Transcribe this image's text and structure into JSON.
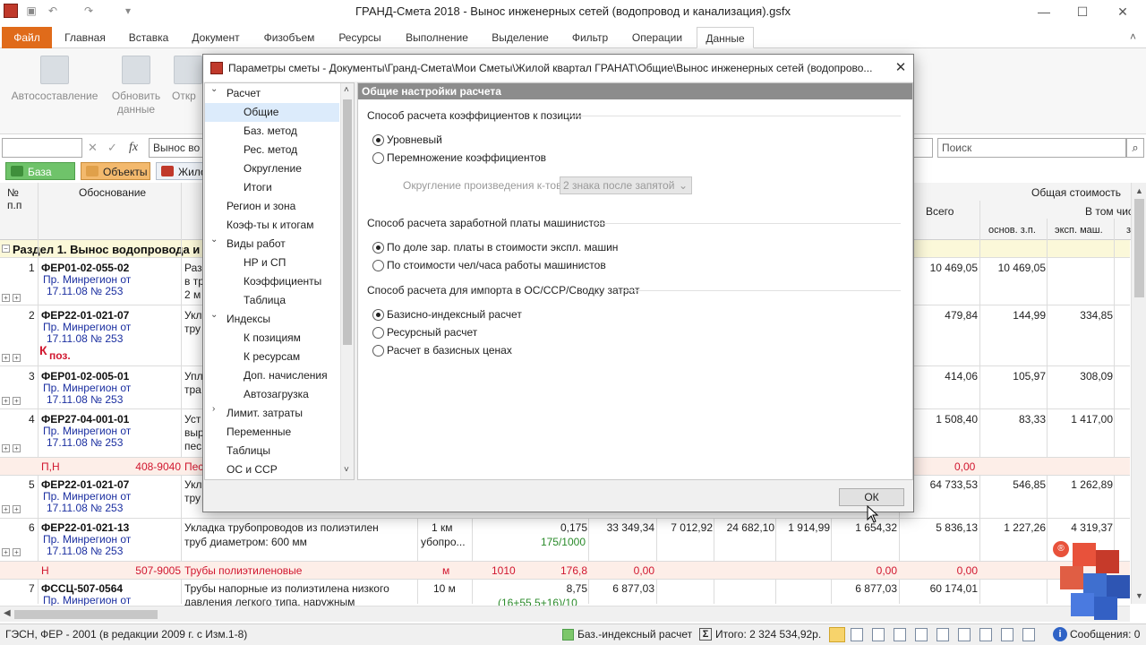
{
  "app": {
    "title": "ГРАНД-Смета 2018 - Вынос инженерных сетей (водопровод и канализация).gsfx"
  },
  "window_controls": {
    "minimize": "—",
    "maximize": "☐",
    "close": "✕"
  },
  "ribbon": {
    "tabs": [
      "Файл",
      "Главная",
      "Вставка",
      "Документ",
      "Физобъем",
      "Ресурсы",
      "Выполнение",
      "Выделение",
      "Фильтр",
      "Операции",
      "Данные"
    ],
    "active_tab": "Данные",
    "buttons": {
      "auto_compose": "Автосоставление",
      "update_data_1": "Обновить",
      "update_data_2": "данные",
      "open_partial": "Откр"
    }
  },
  "formula_bar": {
    "cell_value": "Вынос во",
    "search_placeholder": "Поиск",
    "fx": "fx"
  },
  "source_tabs": {
    "base": "База",
    "objects": "Объекты",
    "residential": "Жило"
  },
  "grid": {
    "headers": {
      "num": "№ п.п",
      "basis": "Обоснование",
      "total_cost": "Общая стоимость",
      "total": "Всего",
      "incl": "В том чис",
      "base_salary": "основ. з.п.",
      "machine_exp": "эксп. маш."
    },
    "section_title": "Раздел 1. Вынос водопровода и",
    "rows": [
      {
        "n": "1",
        "code": "ФЕР01-02-055-02",
        "src1": "Пр. Минрегион от",
        "src2": "17.11.08 № 253",
        "desc": "Раз",
        "desc2": "в тр",
        "desc3": "2 м",
        "total": "10 469,05",
        "base": "10 469,05",
        "mach": ""
      },
      {
        "n": "2",
        "code": "ФЕР22-01-021-07",
        "src1": "Пр. Минрегион от",
        "src2": "17.11.08 № 253",
        "desc": "Укл",
        "desc2": "тру",
        "kpos_k": "К",
        "kpos": "поз.",
        "total": "479,84",
        "base": "144,99",
        "mach": "334,85"
      },
      {
        "n": "3",
        "code": "ФЕР01-02-005-01",
        "src1": "Пр. Минрегион от",
        "src2": "17.11.08 № 253",
        "desc": "Упл",
        "desc2": "тра",
        "total": "414,06",
        "base": "105,97",
        "mach": "308,09"
      },
      {
        "n": "4",
        "code": "ФЕР27-04-001-01",
        "src1": "Пр. Минрегион от",
        "src2": "17.11.08 № 253",
        "desc": "Уст",
        "desc2": "выр",
        "desc3": "пес",
        "total": "1 508,40",
        "base": "83,33",
        "mach": "1 417,00"
      },
      {
        "pn": "П,Н",
        "pcode": "408-9040",
        "pdesc": "Пес",
        "ptotal": "0,00"
      },
      {
        "n": "5",
        "code": "ФЕР22-01-021-07",
        "src1": "Пр. Минрегион от",
        "src2": "17.11.08 № 253",
        "desc": "Укл",
        "desc2": "тру",
        "total": "64 733,53",
        "base": "546,85",
        "mach": "1 262,89"
      },
      {
        "n": "6",
        "code": "ФЕР22-01-021-13",
        "src1": "Пр. Минрегион от",
        "src2": "17.11.08 № 253",
        "desc": "Укладка трубопроводов из полиэтилен",
        "desc2": "труб диаметром: 600 мм",
        "unit1": "1 км",
        "unit2": "убопро...",
        "qty": "0,175",
        "qty2": "175/1000",
        "c1": "33 349,34",
        "c2": "7 012,92",
        "c3": "24 682,10",
        "c4": "1 914,99",
        "c5": "1 654,32",
        "total": "5 836,13",
        "base": "1 227,26",
        "mach": "4 319,37"
      },
      {
        "pn": "Н",
        "pcode": "507-9005",
        "pdesc": "Трубы полиэтиленовые",
        "punit": "м",
        "pq": "1010",
        "pqty": "176,8",
        "pc1": "0,00",
        "pc5": "0,00",
        "ptotal": "0,00"
      },
      {
        "n": "7",
        "code": "ФССЦ-507-0564",
        "src1": "Пр. Минрегион от",
        "desc": "Трубы напорные из полиэтилена низкого",
        "desc2": "давления легкого типа, наружным",
        "unit1": "10 м",
        "qty": "8,75",
        "qty2": "(16+55,5+16)/10",
        "c1": "6 877,03",
        "c5": "6 877,03",
        "total": "60 174,01"
      }
    ]
  },
  "dialog": {
    "title": "Параметры сметы - Документы\\Гранд-Смета\\Мои Сметы\\Жилой квартал ГРАНАТ\\Общие\\Вынос инженерных сетей (водопрово...",
    "close": "✕",
    "tree": [
      {
        "label": "Расчет",
        "level": 0,
        "chev": "⌄"
      },
      {
        "label": "Общие",
        "level": 1,
        "selected": true
      },
      {
        "label": "Баз. метод",
        "level": 1
      },
      {
        "label": "Рес. метод",
        "level": 1
      },
      {
        "label": "Округление",
        "level": 1
      },
      {
        "label": "Итоги",
        "level": 1
      },
      {
        "label": "Регион и зона",
        "level": 0
      },
      {
        "label": "Коэф-ты к итогам",
        "level": 0
      },
      {
        "label": "Виды работ",
        "level": 0,
        "chev": "⌄"
      },
      {
        "label": "НР и СП",
        "level": 1
      },
      {
        "label": "Коэффициенты",
        "level": 1
      },
      {
        "label": "Таблица",
        "level": 1
      },
      {
        "label": "Индексы",
        "level": 0,
        "chev": "⌄"
      },
      {
        "label": "К позициям",
        "level": 1
      },
      {
        "label": "К ресурсам",
        "level": 1
      },
      {
        "label": "Доп. начисления",
        "level": 1
      },
      {
        "label": "Автозагрузка",
        "level": 1
      },
      {
        "label": "Лимит. затраты",
        "level": 0,
        "chev": "›"
      },
      {
        "label": "Переменные",
        "level": 0
      },
      {
        "label": "Таблицы",
        "level": 0
      },
      {
        "label": "ОС и ССР",
        "level": 0
      }
    ],
    "panel_header": "Общие настройки расчета",
    "group1": {
      "title": "Способ расчета коэффициентов к позиции",
      "options": [
        "Уровневый",
        "Перемножение коэффициентов"
      ],
      "selected": 0,
      "rounding_label": "Округление произведения к-тов:",
      "rounding_value": "2 знака после запятой"
    },
    "group2": {
      "title": "Способ расчета заработной платы машинистов",
      "options": [
        "По доле зар. платы в стоимости экспл. машин",
        "По стоимости чел/часа работы машинистов"
      ],
      "selected": 0
    },
    "group3": {
      "title": "Способ расчета для импорта в ОС/ССР/Сводку затрат",
      "options": [
        "Базисно-индексный расчет",
        "Ресурсный расчет",
        "Расчет в базисных ценах"
      ],
      "selected": 0
    },
    "ok": "ОК"
  },
  "statusbar": {
    "norm_base": "ГЭСН, ФЕР - 2001 (в редакции 2009 г. с Изм.1-8)",
    "calc_method": "Баз.-индексный расчет",
    "total": "Итого: 2 324 534,92р.",
    "messages": "Сообщения: 0"
  },
  "colors": {
    "file_tab": "#e06b1a",
    "base_tab": "#6fc36a",
    "objects_tab": "#f3b96d",
    "section_bg": "#fbf8d9",
    "resource_row_bg": "#fdeee8",
    "dialog_header_bg": "#8c8c8c"
  }
}
